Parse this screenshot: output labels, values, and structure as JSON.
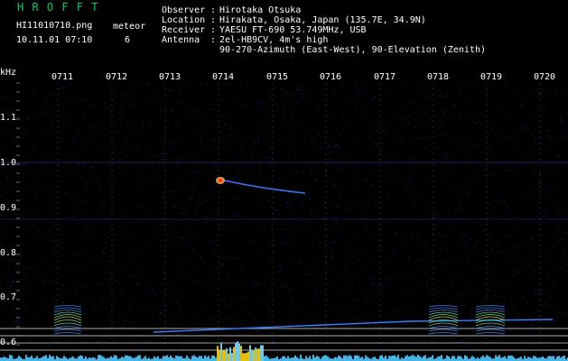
{
  "header": {
    "brand": "H R O F F T",
    "filename": "HI11010710.png",
    "datetime": "10.11.01 07:10",
    "meteor_label": "meteor",
    "meteor_count": "6"
  },
  "info": [
    {
      "key": "Observer",
      "value": "Hirotaka Otsuka"
    },
    {
      "key": "Location",
      "value": "Hirakata, Osaka, Japan (135.7E, 34.9N)"
    },
    {
      "key": "Receiver",
      "value": "YAESU FT-690 53.749MHz, USB"
    },
    {
      "key": "Antenna",
      "value": "2el-HB9CV, 4m's high"
    },
    {
      "key": "",
      "value": "90-270-Azimuth (East-West), 90-Elevation (Zenith)"
    }
  ],
  "axes": {
    "y_unit": "kHz",
    "x_ticks": [
      "0711",
      "0712",
      "0713",
      "0714",
      "0715",
      "0716",
      "0717",
      "0718",
      "0719",
      "0720"
    ],
    "y_ticks": [
      "1.1",
      "1.0",
      "0.9",
      "0.8",
      "0.7",
      "0.6"
    ]
  },
  "colors": {
    "background": "#000000",
    "brand": "#00cc66",
    "text": "#ffffff",
    "grid": "#ffffff",
    "noise": "#1a2a9a",
    "trace": "#3a7bff",
    "signal_hot": "#ffd400"
  }
}
